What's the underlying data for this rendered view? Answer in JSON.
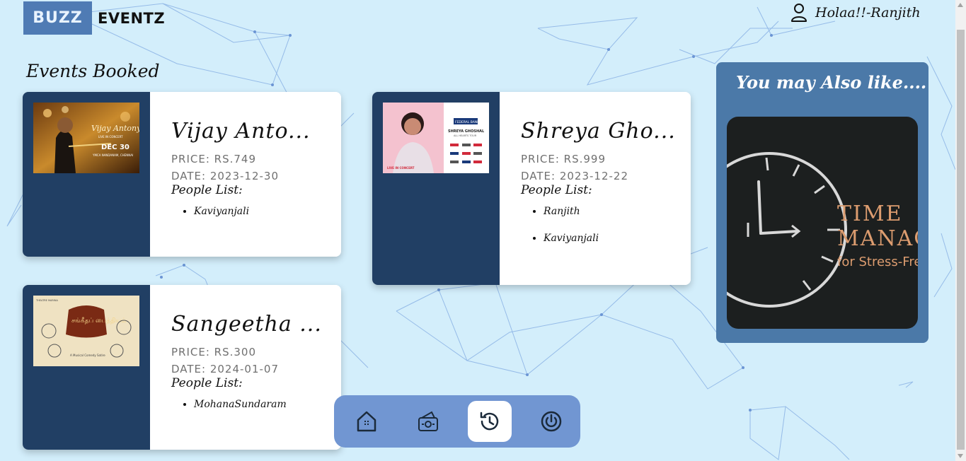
{
  "brand": {
    "box_text": "BUZZ",
    "text": "EVENTZ"
  },
  "user": {
    "greeting": "Holaa!!-Ranjith",
    "icon": "user-icon"
  },
  "section_title": "Events Booked",
  "events": [
    {
      "title": "Vijay Anto...",
      "price": "PRICE: RS.749",
      "date": "DATE: 2023-12-30",
      "people_label": "People List:",
      "people": [
        "Kaviyanjali"
      ],
      "poster": {
        "line1": "Vijay Antony",
        "line2": "LIVE IN CONCERT",
        "line3": "DEC 30",
        "line4": "YMCA NANDANAM, CHENNAI"
      }
    },
    {
      "title": "Shreya Gho...",
      "price": "PRICE: RS.999",
      "date": "DATE: 2023-12-22",
      "people_label": "People List:",
      "people": [
        "Ranjith",
        "Kaviyanjali"
      ],
      "poster": {
        "line1": "FEDERAL BANK",
        "line2": "SHREYA GHOSHAL",
        "line3": "ALL HEARTS TOUR",
        "line4": "LIVE IN CONCERT"
      }
    },
    {
      "title": "Sangeetha ...",
      "price": "PRICE: RS.300",
      "date": "DATE: 2024-01-07",
      "people_label": "People List:",
      "people": [
        "MohanaSundaram"
      ],
      "poster": {
        "line1": "சங்கீதப் பைத்தியம்",
        "line2": "THEATRE MARINA",
        "line3": "A Musical Comedy Satire"
      }
    }
  ],
  "sidebar": {
    "title": "You may Also like....",
    "ad": {
      "line1": "TIME",
      "line2": "MANAGE",
      "line3": "for Stress-Free"
    }
  },
  "nav": [
    {
      "name": "home",
      "icon": "home-icon",
      "active": false
    },
    {
      "name": "events",
      "icon": "ticket-icon",
      "active": false
    },
    {
      "name": "history",
      "icon": "history-icon",
      "active": true
    },
    {
      "name": "logout",
      "icon": "power-icon",
      "active": false
    }
  ],
  "colors": {
    "background": "#d3eefb",
    "card_dark": "#213f64",
    "sidebar": "#4b79a8",
    "nav": "#7196d2",
    "logo_box": "#4f7bb4"
  }
}
